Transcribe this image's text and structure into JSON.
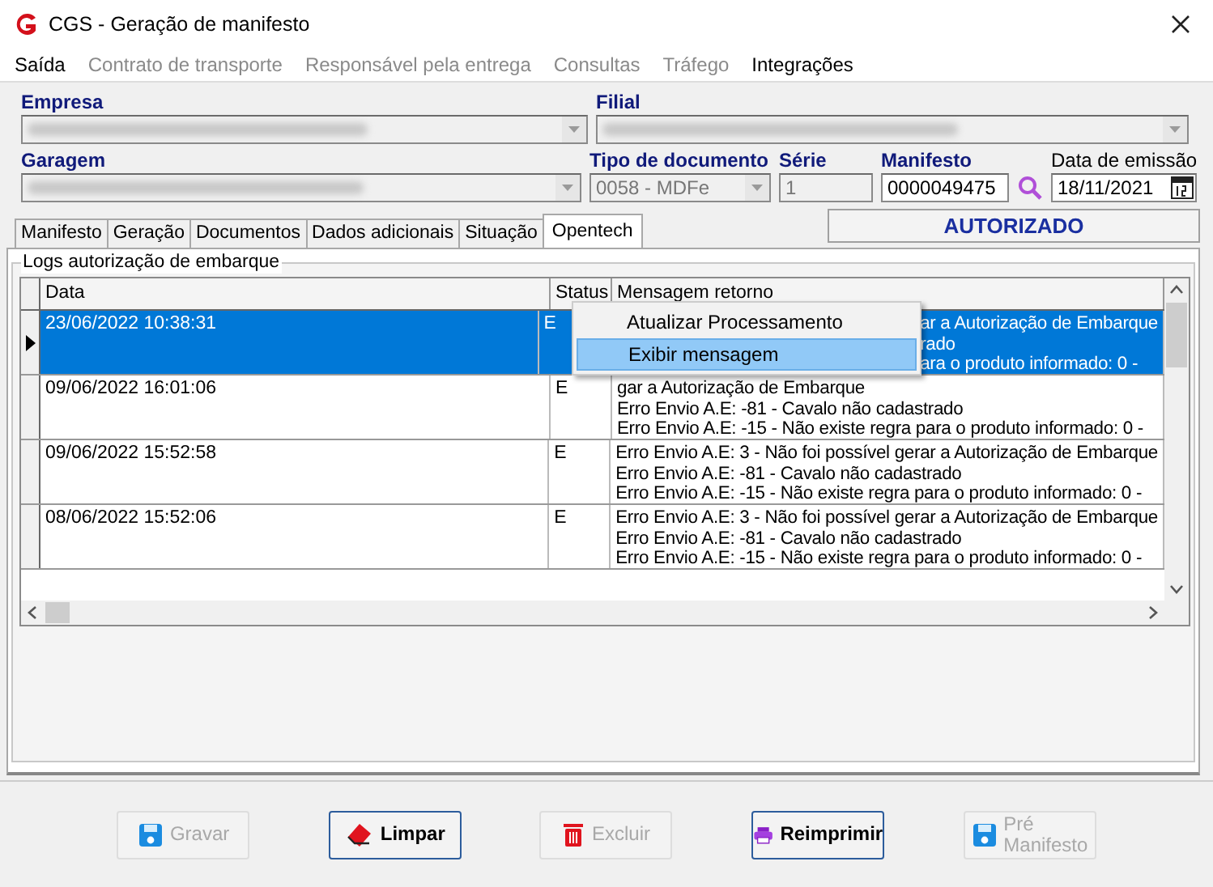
{
  "window": {
    "title": "CGS - Geração de manifesto"
  },
  "menu": [
    {
      "label": "Saída",
      "disabled": false
    },
    {
      "label": "Contrato de transporte",
      "disabled": true
    },
    {
      "label": "Responsável pela entrega",
      "disabled": true
    },
    {
      "label": "Consultas",
      "disabled": true
    },
    {
      "label": "Tráfego",
      "disabled": true
    },
    {
      "label": "Integrações",
      "disabled": false
    }
  ],
  "field_rows": [
    [
      {
        "label": "Empresa",
        "kind": "combo",
        "bold_label": true,
        "redacted": true
      },
      {
        "label": "Filial",
        "kind": "combo",
        "bold_label": true,
        "redacted": true
      }
    ],
    [
      {
        "label": "Garagem",
        "kind": "combo",
        "bold_label": true,
        "redacted": true
      },
      {
        "label": "Tipo de documento",
        "kind": "combo",
        "bold_label": true,
        "value": "0058 - MDFe"
      },
      {
        "label": "Série",
        "kind": "text",
        "bold_label": true,
        "value": "1"
      },
      {
        "label": "Manifesto",
        "kind": "search",
        "bold_label": true,
        "value": "0000049475"
      },
      {
        "label": "Data de emissão",
        "kind": "date",
        "bold_label": false,
        "value": "18/11/2021"
      }
    ]
  ],
  "tabs": [
    {
      "label": "Manifesto",
      "selected": false
    },
    {
      "label": "Geração",
      "selected": false
    },
    {
      "label": "Documentos",
      "selected": false
    },
    {
      "label": "Dados adicionais",
      "selected": false
    },
    {
      "label": "Situação",
      "selected": false
    },
    {
      "label": "Opentech",
      "selected": true
    }
  ],
  "status_box": "AUTORIZADO",
  "group": {
    "title": "Logs autorização de embarque",
    "columns": [
      "Data",
      "Status",
      "Mensagem retorno"
    ],
    "rows": [
      {
        "selected": true,
        "covered": true,
        "data": "23/06/2022 10:38:31",
        "status": "E",
        "message": [
          "ar a Autorização de Embarque",
          "rado",
          "ara o produto informado: 0 -"
        ]
      },
      {
        "selected": false,
        "covered": false,
        "data": "09/06/2022 16:01:06",
        "status": "E",
        "message": [
          "gar a Autorização de Embarque",
          "Erro Envio A.E: -81 - Cavalo não cadastrado",
          "Erro Envio A.E: -15 -  Não existe regra para o produto informado: 0 -"
        ]
      },
      {
        "selected": false,
        "covered": false,
        "data": "09/06/2022 15:52:58",
        "status": "E",
        "message": [
          "Erro Envio A.E: 3 - Não foi possível gerar a Autorização de Embarque",
          "Erro Envio A.E: -81 - Cavalo não cadastrado",
          "Erro Envio A.E: -15 -  Não existe regra para o produto informado: 0 -"
        ]
      },
      {
        "selected": false,
        "covered": false,
        "data": "08/06/2022 15:52:06",
        "status": "E",
        "message": [
          "Erro Envio A.E: 3 - Não foi possível gerar a Autorização de Embarque",
          "Erro Envio A.E: -81 - Cavalo não cadastrado",
          "Erro Envio A.E: -15 -  Não existe regra para o produto informado: 0 -"
        ]
      }
    ],
    "context_menu": [
      {
        "label": "Atualizar Processamento",
        "selected": false
      },
      {
        "label": "Exibir mensagem",
        "selected": true
      }
    ]
  },
  "buttons": [
    {
      "label": "Gravar",
      "disabled": true
    },
    {
      "label": "Limpar",
      "disabled": false
    },
    {
      "label": "Excluir",
      "disabled": true
    },
    {
      "label": "Reimprimir",
      "disabled": false
    },
    {
      "label": "Pré\nManifesto",
      "disabled": true
    }
  ]
}
